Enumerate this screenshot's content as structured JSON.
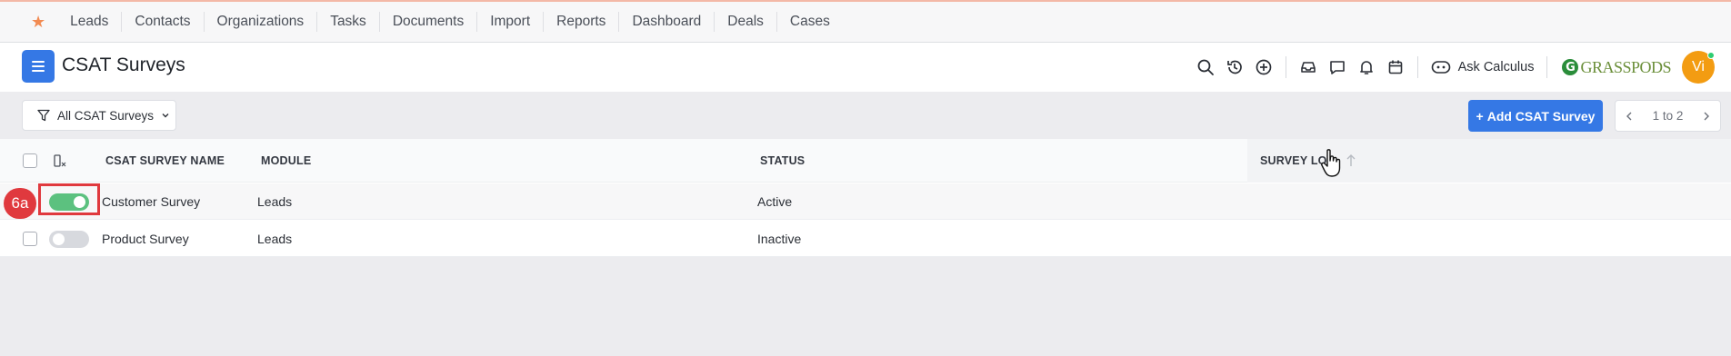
{
  "topnav": {
    "items": [
      "Leads",
      "Contacts",
      "Organizations",
      "Tasks",
      "Documents",
      "Import",
      "Reports",
      "Dashboard",
      "Deals",
      "Cases"
    ]
  },
  "header": {
    "title": "CSAT Surveys",
    "ask_label": "Ask Calculus",
    "brand_text": "GRASSPODS",
    "brand_initial": "G",
    "avatar_initials": "Vi"
  },
  "toolbar": {
    "filter_label": "All CSAT Surveys",
    "add_label": "Add CSAT Survey",
    "pager_text": "1 to 2"
  },
  "table": {
    "columns": [
      "CSAT SURVEY NAME",
      "MODULE",
      "STATUS",
      "SURVEY LO"
    ],
    "rows": [
      {
        "name": "Customer Survey",
        "module": "Leads",
        "status": "Active",
        "enabled": true
      },
      {
        "name": "Product Survey",
        "module": "Leads",
        "status": "Inactive",
        "enabled": false
      }
    ]
  },
  "annotation": {
    "marker_label": "6a"
  },
  "colors": {
    "accent": "#3578e5",
    "toggle_on": "#5cc17f",
    "highlight": "#e0393e",
    "avatar": "#f39c12"
  }
}
